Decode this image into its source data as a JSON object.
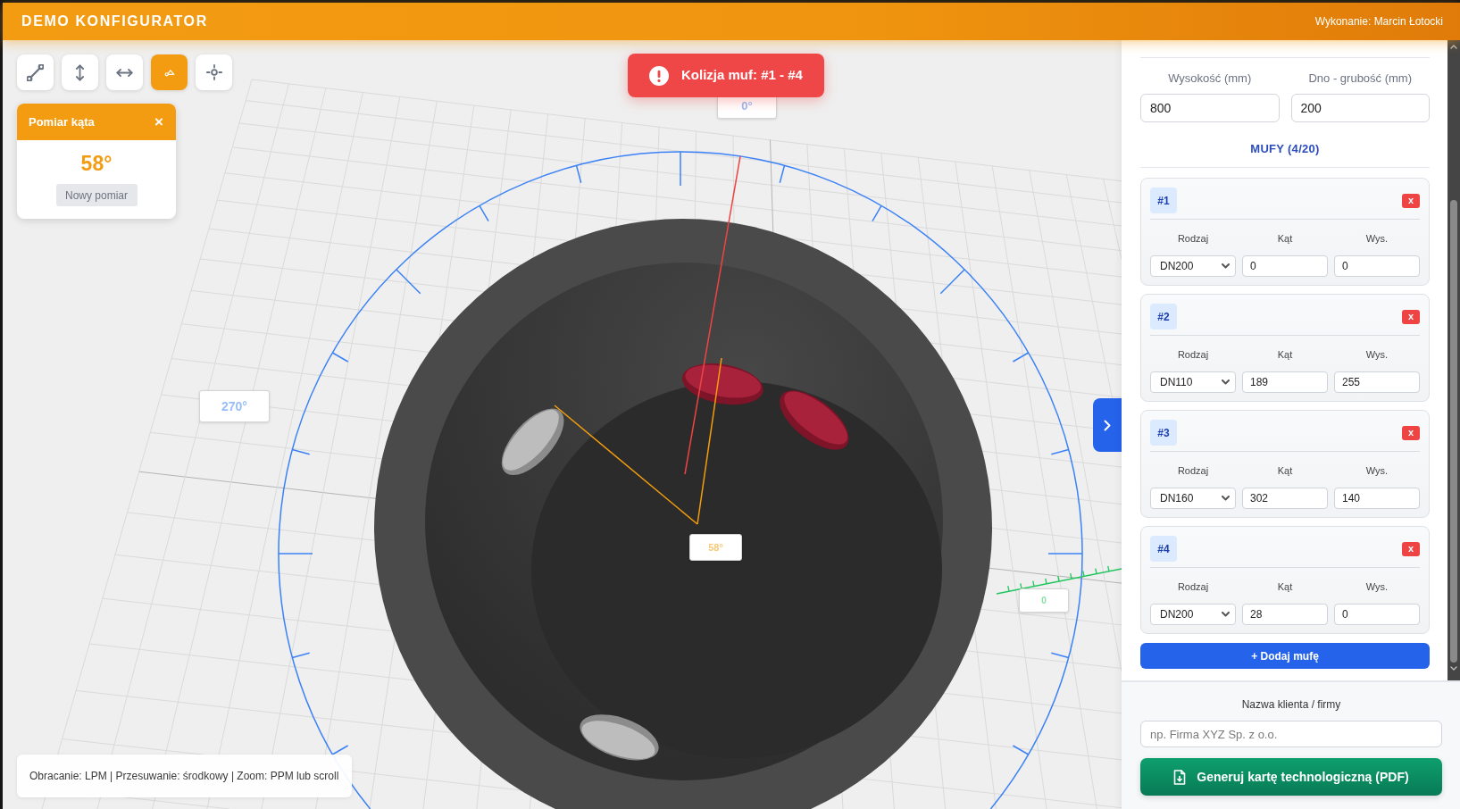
{
  "header": {
    "title": "DEMO KONFIGURATOR",
    "author": "Wykonanie: Marcin Łotocki"
  },
  "toolbar": [
    {
      "kind": "distance",
      "selected": false
    },
    {
      "kind": "vertical",
      "selected": false
    },
    {
      "kind": "horizontal",
      "selected": false
    },
    {
      "kind": "angle",
      "selected": true
    },
    {
      "kind": "point",
      "selected": false
    }
  ],
  "angle_panel": {
    "title": "Pomiar kąta",
    "close": "×",
    "value": "58°",
    "button": {
      "label": "Nowy pomiar",
      "disabled": true
    }
  },
  "alert": {
    "text": "Kolizja muf: #1 - #4"
  },
  "viewport": {
    "ring_labels": [
      "0°",
      "270°"
    ],
    "measure_label": "58°",
    "axis_label": "0",
    "sockets": [
      {
        "colliding": true
      },
      {
        "colliding": false
      },
      {
        "colliding": false
      },
      {
        "colliding": true
      }
    ],
    "hint": "Obracanie: LPM | Przesuwanie: środkowy | Zoom: PPM lub scroll"
  },
  "panel": {
    "fields": [
      {
        "label": "Wysokość (mm)",
        "value": "800"
      },
      {
        "label": "Dno - grubość (mm)",
        "value": "200"
      }
    ],
    "section_title": "MUFY (4/20)",
    "muffs": [
      {
        "number": "#1",
        "remove": "x",
        "fields": [
          {
            "kind": "select",
            "label": "Rodzaj",
            "value": "DN200"
          },
          {
            "kind": "input",
            "label": "Kąt",
            "value": "0"
          },
          {
            "kind": "input",
            "label": "Wys.",
            "value": "0"
          }
        ]
      },
      {
        "number": "#2",
        "remove": "x",
        "fields": [
          {
            "kind": "select",
            "label": "Rodzaj",
            "value": "DN110"
          },
          {
            "kind": "input",
            "label": "Kąt",
            "value": "189"
          },
          {
            "kind": "input",
            "label": "Wys.",
            "value": "255"
          }
        ]
      },
      {
        "number": "#3",
        "remove": "x",
        "fields": [
          {
            "kind": "select",
            "label": "Rodzaj",
            "value": "DN160"
          },
          {
            "kind": "input",
            "label": "Kąt",
            "value": "302"
          },
          {
            "kind": "input",
            "label": "Wys.",
            "value": "140"
          }
        ]
      },
      {
        "number": "#4",
        "remove": "x",
        "fields": [
          {
            "kind": "select",
            "label": "Rodzaj",
            "value": "DN200"
          },
          {
            "kind": "input",
            "label": "Kąt",
            "value": "28"
          },
          {
            "kind": "input",
            "label": "Wys.",
            "value": "0"
          }
        ]
      }
    ],
    "add_button": "+ Dodaj mufę",
    "client": {
      "label": "Nazwa klienta / firmy",
      "placeholder": "np. Firma XYZ Sp. z o.o."
    },
    "generate_button": "Generuj kartę technologiczną (PDF)"
  }
}
